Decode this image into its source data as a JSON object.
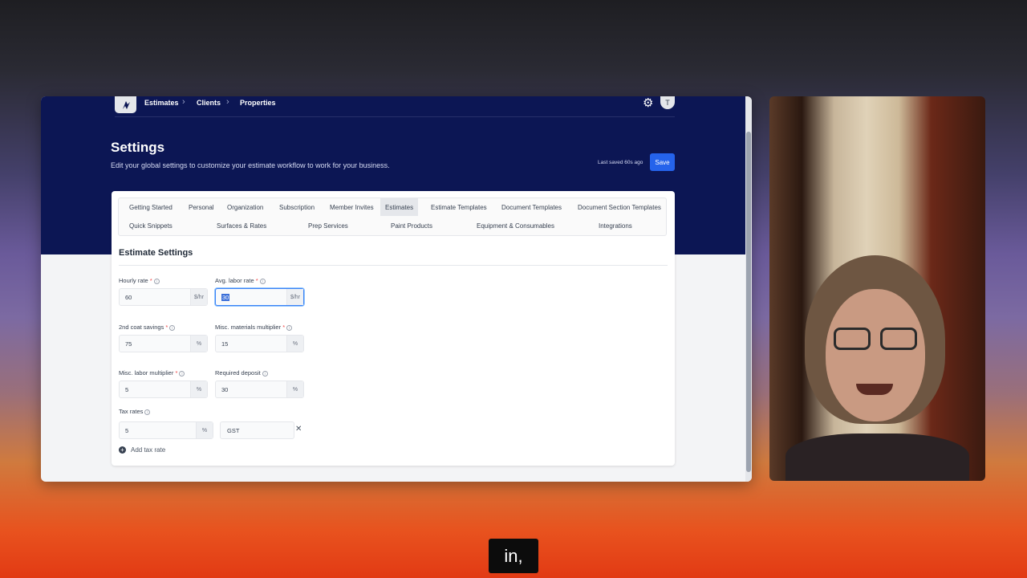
{
  "nav": {
    "breadcrumbs": [
      "Estimates",
      "Clients",
      "Properties"
    ],
    "avatar_initial": "T"
  },
  "header": {
    "title": "Settings",
    "subtitle": "Edit your global settings to customize your estimate workflow to work for your business.",
    "last_saved": "Last saved 60s ago",
    "save_label": "Save"
  },
  "tabs": {
    "row1": [
      "Getting Started",
      "Personal",
      "Organization",
      "Subscription",
      "Member Invites",
      "Estimates",
      "Estimate Templates",
      "Document Templates",
      "Document Section Templates"
    ],
    "row2": [
      "Quick Snippets",
      "Surfaces & Rates",
      "Prep Services",
      "Paint Products",
      "Equipment & Consumables",
      "Integrations"
    ],
    "active": "Estimates"
  },
  "section": {
    "title": "Estimate Settings"
  },
  "fields": {
    "hourly_rate": {
      "label": "Hourly rate",
      "value": "60",
      "unit": "$/hr"
    },
    "avg_labor_rate": {
      "label": "Avg. labor rate",
      "value": "30",
      "unit": "$/hr"
    },
    "second_coat_savings": {
      "label": "2nd coat savings",
      "value": "75",
      "unit": "%"
    },
    "misc_materials_multiplier": {
      "label": "Misc. materials multiplier",
      "value": "15",
      "unit": "%"
    },
    "misc_labor_multiplier": {
      "label": "Misc. labor multiplier",
      "value": "5",
      "unit": "%"
    },
    "required_deposit": {
      "label": "Required deposit",
      "value": "30",
      "unit": "%"
    },
    "tax_rates": {
      "label": "Tax rates",
      "value": "5",
      "unit": "%",
      "name": "GST"
    }
  },
  "add_tax_rate_label": "Add tax rate",
  "caption": "in,"
}
